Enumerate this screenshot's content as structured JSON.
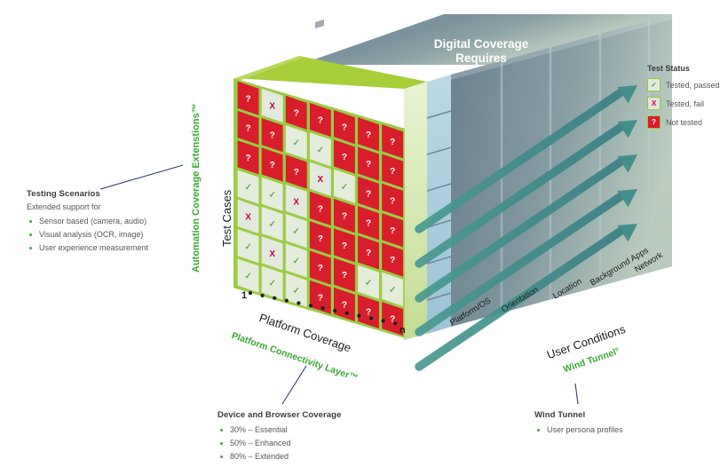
{
  "title": {
    "line1": "Digital Coverage",
    "line2": "Requires"
  },
  "axes": {
    "y_label": "Test Cases",
    "y_green_label": "Automation Coverage Extenstions™",
    "x_label": "Platform Coverage",
    "x_green_label": "Platform Connectivity Layer™",
    "z_label": "User Conditions",
    "z_green_label": "Wind Tunnel°",
    "x_start": "1",
    "x_end": "n",
    "depth_labels": [
      "Platform/OS",
      "Orientation",
      "Location",
      "Background Apps",
      "Network"
    ]
  },
  "legend": {
    "title": "Test Status",
    "items": [
      {
        "glyph": "✓",
        "label": "Tested, passed",
        "state": "pass"
      },
      {
        "glyph": "X",
        "label": "Tested, fail",
        "state": "fail"
      },
      {
        "glyph": "?",
        "label": "Not tested",
        "state": "none"
      }
    ]
  },
  "annotations": {
    "testing_scenarios": {
      "title": "Testing Scenarios",
      "subtitle": "Extended support for",
      "items": [
        "Sensor based (camera, audio)",
        "Visual analysis (OCR, image)",
        "User experience measurement"
      ]
    },
    "device_browser": {
      "title": "Device and Browser Coverage",
      "items": [
        "30% – Essential",
        "50% – Enhanced",
        "80% – Extended"
      ]
    },
    "wind_tunnel": {
      "title": "Wind Tunnel",
      "items": [
        "User persona profiles"
      ]
    }
  },
  "colors": {
    "green_accent": "#3aaa35",
    "red_not_tested": "#d81e2c",
    "cell_border_green": "#95c93d",
    "face_green_top": "#a6ce39",
    "face_green_side": "#ddeec0",
    "teal_arrow": "#3f8c88",
    "dark_text": "#1d1d1b",
    "grey_text": "#575756"
  },
  "chart_data": {
    "type": "heatmap",
    "title": "Digital Coverage Requires",
    "xlabel": "Platform Coverage",
    "ylabel": "Test Cases",
    "zlabel": "User Conditions",
    "legend_states": [
      "passed",
      "fail",
      "not-tested"
    ],
    "rows": 7,
    "cols": 7,
    "grid": [
      [
        "not-tested",
        "fail",
        "not-tested",
        "not-tested",
        "not-tested",
        "not-tested",
        "not-tested"
      ],
      [
        "not-tested",
        "not-tested",
        "passed",
        "passed",
        "not-tested",
        "not-tested",
        "not-tested"
      ],
      [
        "not-tested",
        "not-tested",
        "not-tested",
        "fail",
        "passed",
        "not-tested",
        "not-tested"
      ],
      [
        "passed",
        "passed",
        "fail",
        "not-tested",
        "not-tested",
        "not-tested",
        "not-tested"
      ],
      [
        "fail",
        "passed",
        "passed",
        "not-tested",
        "not-tested",
        "not-tested",
        "not-tested"
      ],
      [
        "passed",
        "fail",
        "passed",
        "not-tested",
        "not-tested",
        "passed",
        "passed"
      ],
      [
        "passed",
        "passed",
        "passed",
        "not-tested",
        "not-tested",
        "not-tested",
        "not-tested"
      ]
    ]
  }
}
